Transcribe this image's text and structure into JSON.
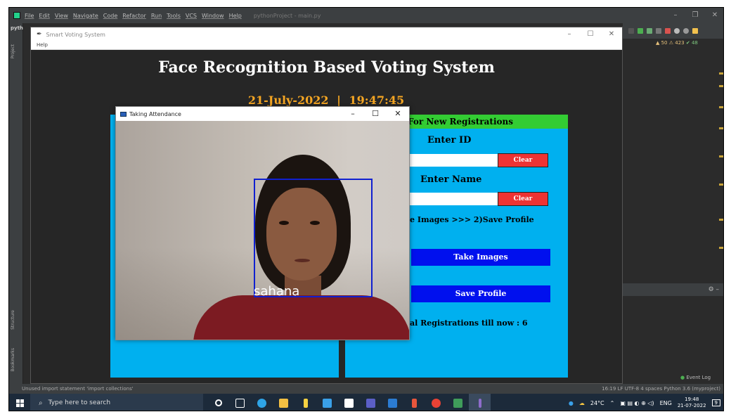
{
  "ide": {
    "menu": [
      "File",
      "Edit",
      "View",
      "Navigate",
      "Code",
      "Refactor",
      "Run",
      "Tools",
      "VCS",
      "Window",
      "Help"
    ],
    "title": "pythonProject - main.py",
    "project_label": "pyth",
    "side_tabs": [
      "Project",
      "Structure",
      "Bookmarks"
    ],
    "warnings": {
      "errors": "▲ 50",
      "weak": "⚠ 423",
      "ok": "✔ 48"
    },
    "event_log": "Event Log",
    "status_left": "Unused import statement 'import collections'",
    "status_right": "16:19  LF  UTF-8  4 spaces  Python 3.6 (myproject)"
  },
  "app": {
    "window_title": "Smart Voting System",
    "menu_help": "Help",
    "heading": "Face Recognition Based Voting System",
    "date": "21-July-2022",
    "separator": "|",
    "time": "19:47:45",
    "registration": {
      "header": "For New Registrations",
      "id_label": "Enter ID",
      "name_label": "Enter Name",
      "clear_label": "Clear",
      "steps": "e Images  >>>  2)Save Profile",
      "take_images": "Take Images",
      "save_profile": "Save Profile",
      "total": "al Registrations till now  : 6"
    }
  },
  "camera": {
    "window_title": "Taking Attendance",
    "detected_name": "sahana"
  },
  "taskbar": {
    "search_placeholder": "Type here to search",
    "weather": "24°C",
    "lang": "ENG",
    "time": "19:48",
    "date": "21-07-2022",
    "notif_count": "9"
  },
  "colors": {
    "panel_blue": "#00b0ef",
    "header_green": "#33cc33",
    "button_blue": "#0010ee",
    "clear_red": "#ee3333",
    "date_orange": "#f5a623",
    "face_box": "#1020d0"
  }
}
